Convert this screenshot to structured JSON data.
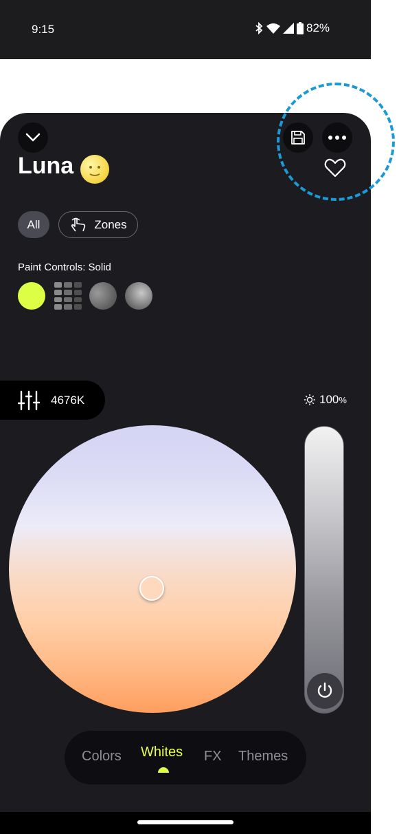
{
  "status_bar": {
    "time": "9:15",
    "battery": "82%",
    "icons": [
      "bluetooth-icon",
      "wifi-icon",
      "signal-icon",
      "battery-icon"
    ]
  },
  "header": {
    "title": "Luna",
    "emoji": "🌝",
    "icons": [
      "chevron-down-icon",
      "save-icon",
      "more-icon",
      "heart-icon"
    ]
  },
  "filters": {
    "all_label": "All",
    "zones_label": "Zones"
  },
  "paint": {
    "label": "Paint Controls: Solid",
    "solid_color": "#dcff45"
  },
  "color_temp": {
    "value": "4676K"
  },
  "brightness": {
    "value": "100",
    "unit": "%",
    "level": 1.0
  },
  "tabs": [
    {
      "label": "Colors",
      "active": false
    },
    {
      "label": "Whites",
      "active": true
    },
    {
      "label": "FX",
      "active": false
    },
    {
      "label": "Themes",
      "active": false
    }
  ],
  "colors": {
    "accent": "#dcff45",
    "highlight": "#1c9ad6",
    "background": "#1c1c20"
  }
}
